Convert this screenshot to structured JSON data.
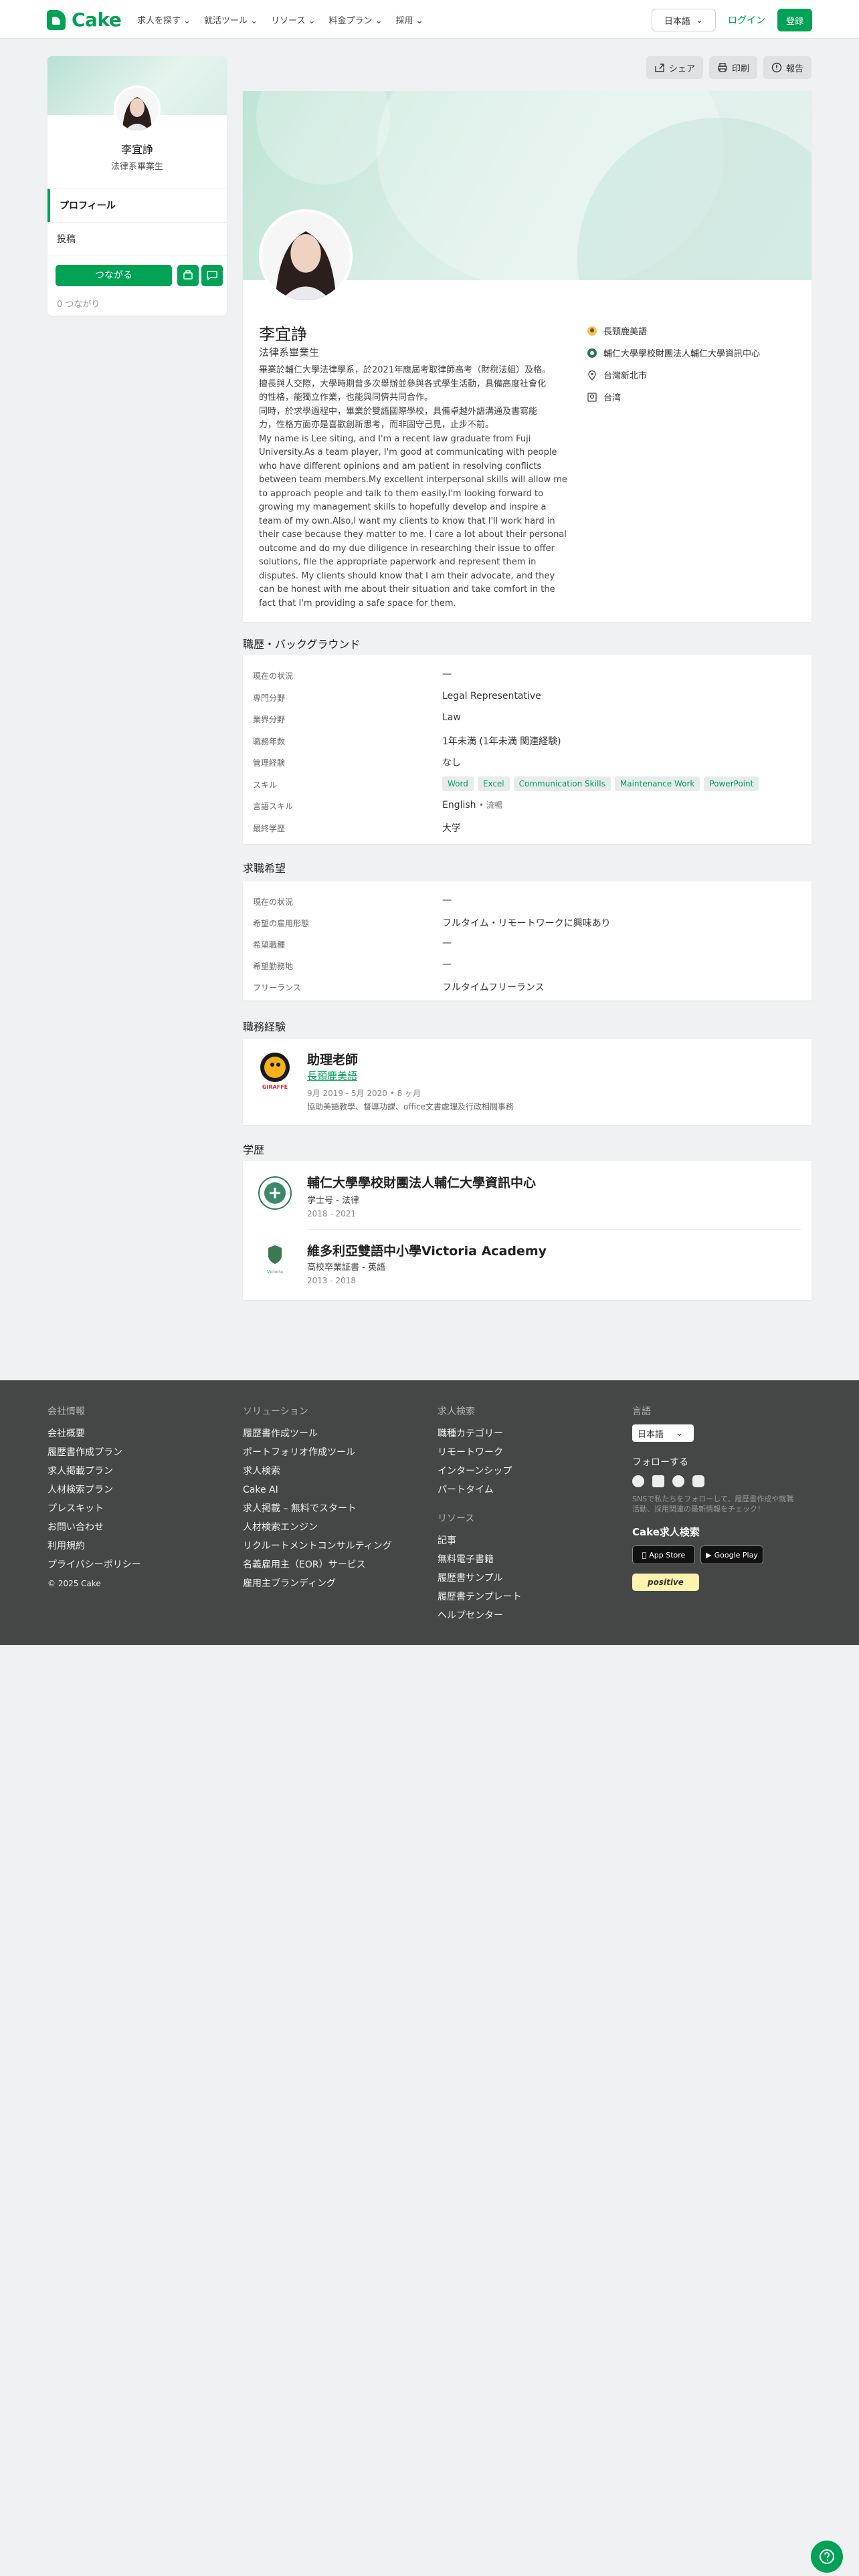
{
  "nav": {
    "brand": "Cake",
    "menu": [
      "求人を探す",
      "就活ツール",
      "リソース",
      "料金プラン",
      "採用"
    ],
    "lang": "日本語",
    "login": "ログイン",
    "signup": "登録"
  },
  "sidebar": {
    "name": "李宜諍",
    "title": "法律系畢業生",
    "tab_profile": "プロフィール",
    "tab_posts": "投稿",
    "connect": "つながる",
    "connections": "0 つながり"
  },
  "actions": {
    "share": "シェア",
    "print": "印刷",
    "report": "報告"
  },
  "profile": {
    "name": "李宜諍",
    "title": "法律系畢業生",
    "bio_lines": [
      "畢業於輔仁大學法律學系，於2021年應屆考取律師高考（財稅法組）及格。",
      "擅長與人交際，大學時期曾多次舉辦並參與各式學生活動，具備高度社會化",
      "的性格，能獨立作業，也能與同儕共同合作。",
      "同時，於求學過程中，畢業於雙語國際學校，具備卓越外語溝通及書寫能",
      "力，性格方面亦是喜歡創新思考，而非固守己見，止步不前。",
      "My name is Lee siting, and I'm a recent law graduate from Fuji",
      "University.As a team player, I'm good at communicating with people",
      "who have different opinions and am patient in resolving conflicts",
      "between team members.My excellent interpersonal skills will allow me",
      "to approach people and talk to them easily.I'm looking forward to",
      "growing my management skills to hopefully develop and inspire a",
      "team of my own.Also,I want my clients to know that I'll work hard in",
      "their case because they matter to me. I care a lot about their personal",
      "outcome and do my due diligence in researching their issue to offer",
      "solutions, file the appropriate paperwork and represent them in",
      "disputes. My clients should know that I am their advocate, and they",
      "can be honest with me about their situation and take comfort in the",
      "fact that I'm providing a safe space for them."
    ],
    "facts": [
      "長頸鹿美語",
      "輔仁大學學校財團法人輔仁大學資訊中心",
      "台灣新北市",
      "台湾"
    ]
  },
  "background": {
    "heading": "職歴・バックグラウンド",
    "rows": [
      {
        "label": "現在の状況",
        "value": "—"
      },
      {
        "label": "専門分野",
        "value": "Legal Representative"
      },
      {
        "label": "業界分野",
        "value": "Law"
      },
      {
        "label": "職務年数",
        "value": "1年未満 (1年未満 関連経験)"
      },
      {
        "label": "管理経験",
        "value": "なし"
      },
      {
        "label": "スキル",
        "value": ""
      },
      {
        "label": "言語スキル",
        "value": "English",
        "note": "• 流暢"
      },
      {
        "label": "最終学歴",
        "value": "大学"
      }
    ],
    "skills": [
      "Word",
      "Excel",
      "Communication Skills",
      "Maintenance Work",
      "PowerPoint"
    ]
  },
  "preferences": {
    "heading": "求職希望",
    "rows": [
      {
        "label": "現在の状況",
        "value": "—"
      },
      {
        "label": "希望の雇用形態",
        "value": "フルタイム・リモートワークに興味あり"
      },
      {
        "label": "希望職種",
        "value": "—"
      },
      {
        "label": "希望勤務地",
        "value": "—"
      },
      {
        "label": "フリーランス",
        "value": "フルタイムフリーランス"
      }
    ]
  },
  "experience": {
    "heading": "職務経験",
    "title": "助理老師",
    "company": "長頸鹿美語",
    "dates": "9月 2019 - 5月 2020 • 8 ヶ月",
    "desc": "協助美語教學、督導功課、office文書處理及行政相關事務",
    "logo_text": "GIRAFFE"
  },
  "education": {
    "heading": "学歴",
    "items": [
      {
        "school": "輔仁大學學校財團法人輔仁大學資訊中心",
        "degree": "学士号 - 法律",
        "years": "2018 - 2021"
      },
      {
        "school": "維多利亞雙語中小學Victoria Academy",
        "degree": "高校卒業証書 - 英語",
        "years": "2013 - 2018"
      }
    ]
  },
  "footer": {
    "col1_title": "会社情報",
    "col1": [
      "会社概要",
      "履歴書作成プラン",
      "求人掲載プラン",
      "人材検索プラン",
      "プレスキット",
      "お問い合わせ",
      "利用規約",
      "プライバシーポリシー",
      "© 2025 Cake"
    ],
    "col2_title": "ソリューション",
    "col2": [
      "履歴書作成ツール",
      "ポートフォリオ作成ツール",
      "求人検索",
      "Cake AI",
      "求人掲載 – 無料でスタート",
      "人材検索エンジン",
      "リクルートメントコンサルティング",
      "名義雇用主（EOR）サービス",
      "雇用主ブランディング"
    ],
    "col3_title": "求人検索",
    "col3": [
      "職種カテゴリー",
      "リモートワーク",
      "インターンシップ",
      "パートタイム"
    ],
    "col3b_title": "リソース",
    "col3b": [
      "記事",
      "無料電子書籍",
      "履歴書サンプル",
      "履歴書テンプレート",
      "ヘルプセンター"
    ],
    "col4_title": "言語",
    "lang": "日本語",
    "follow": "フォローする",
    "follow_note": "SNSで私たちをフォローして、履歴書作成や就職活動、採用関連の最新情報をチェック！",
    "app_title": "Cake求人検索",
    "app_store": "App Store",
    "google_play": "Google Play",
    "badge": "positive"
  }
}
